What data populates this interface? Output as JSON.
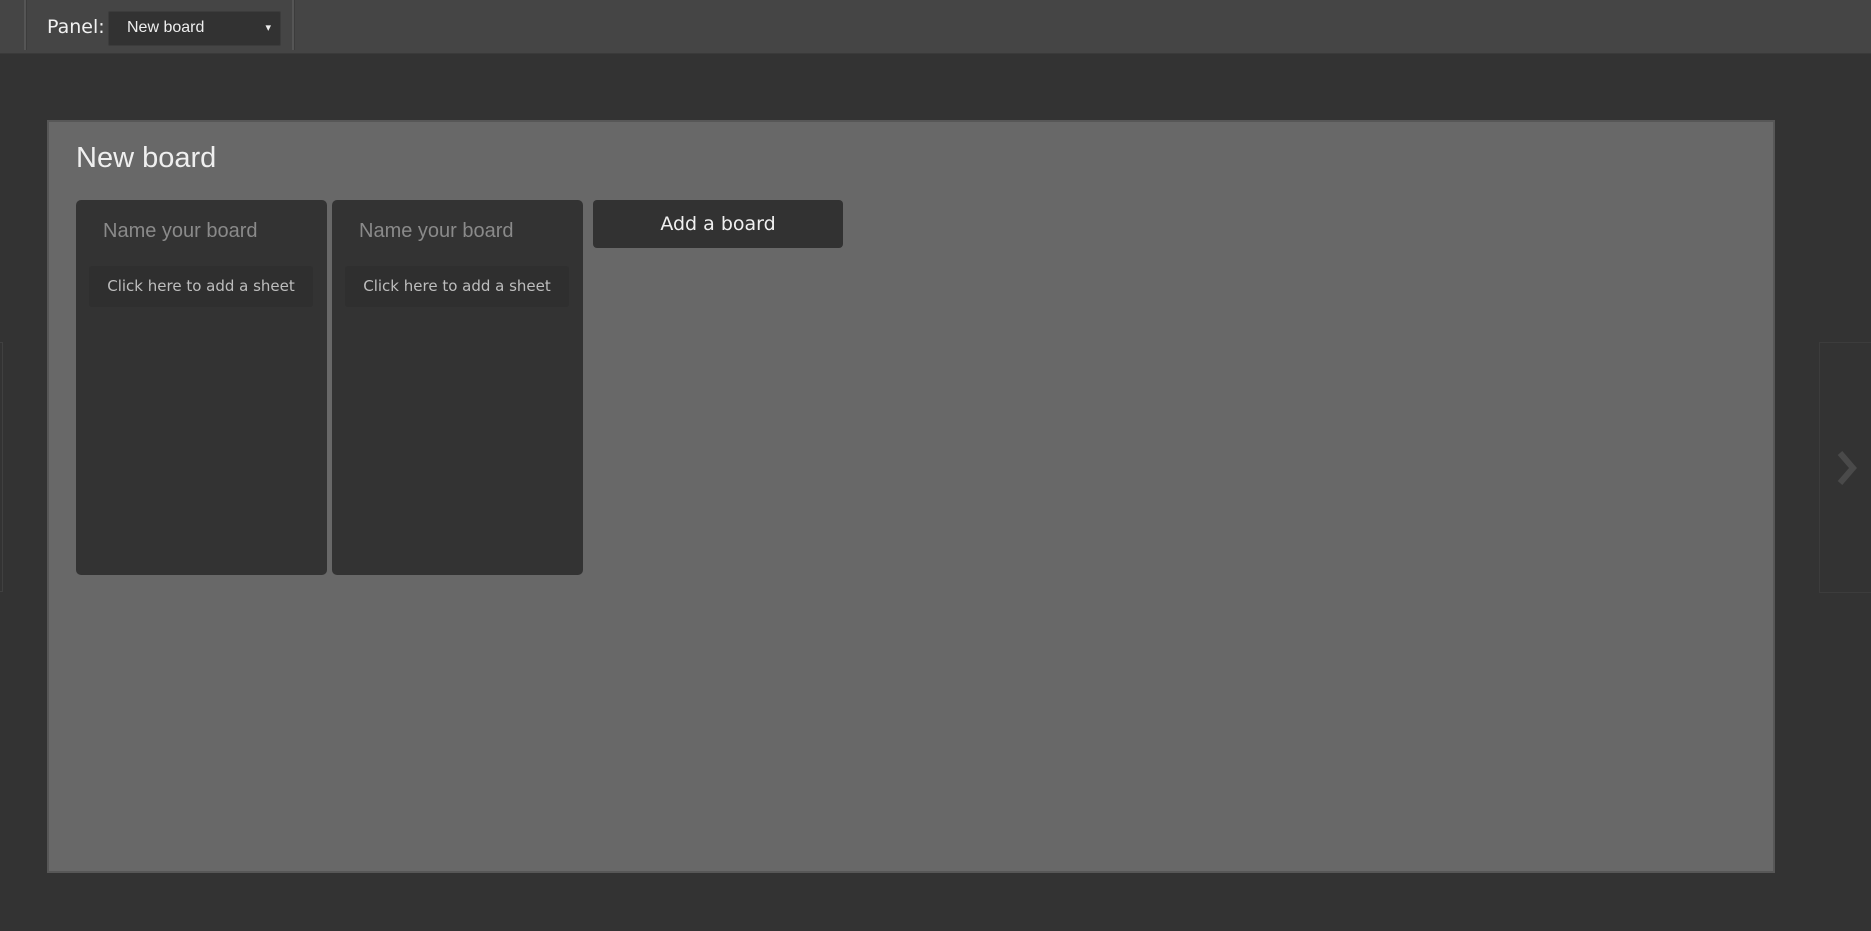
{
  "toolbar": {
    "panel_label": "Panel:",
    "panel_select": {
      "value": "New board",
      "caret": "▾"
    }
  },
  "board": {
    "title": "New board",
    "columns": [
      {
        "name_placeholder": "Name your board",
        "add_sheet_label": "Click here to add a sheet"
      },
      {
        "name_placeholder": "Name your board",
        "add_sheet_label": "Click here to add a sheet"
      }
    ],
    "add_board_label": "Add a board"
  },
  "icons": {
    "next": "chevron-right-icon"
  },
  "colors": {
    "page_background": "#333333",
    "toolbar_background": "#454545",
    "board_background": "#686868",
    "column_background": "#333333"
  }
}
